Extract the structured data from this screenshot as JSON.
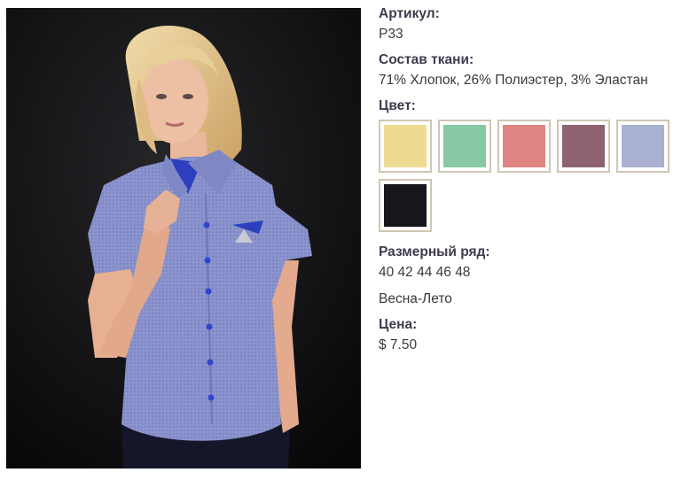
{
  "product": {
    "image_alt": "Блуза голубая с коротким рукавом"
  },
  "details": {
    "article_label": "Артикул:",
    "article_value": "P33",
    "fabric_label": "Состав ткани:",
    "fabric_value": "71% Хлопок, 26% Полиэстер, 3% Эластан",
    "color_label": "Цвет:",
    "swatches": [
      {
        "name": "yellow",
        "color": "#eddb92"
      },
      {
        "name": "mint",
        "color": "#86c9a4"
      },
      {
        "name": "coral",
        "color": "#de8483"
      },
      {
        "name": "mauve",
        "color": "#8d6273"
      },
      {
        "name": "lavender",
        "color": "#aab0cf"
      },
      {
        "name": "black",
        "color": "#16161b"
      }
    ],
    "size_label": "Размерный ряд:",
    "size_value": "40 42 44 46 48",
    "season_value": "Весна-Лето",
    "price_label": "Цена:",
    "price_value": "$ 7.50"
  }
}
